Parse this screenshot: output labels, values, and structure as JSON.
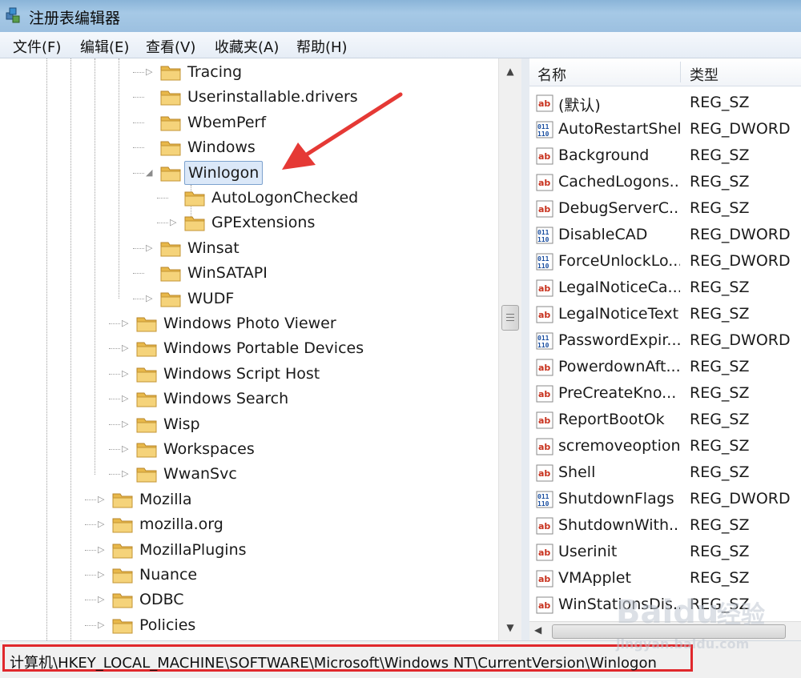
{
  "window": {
    "title": "注册表编辑器"
  },
  "menu": [
    "文件(F)",
    "编辑(E)",
    "查看(V)",
    "收藏夹(A)",
    "帮助(H)"
  ],
  "tree": [
    {
      "label": "Tracing",
      "expander": "▷"
    },
    {
      "label": "Userinstallable.drivers",
      "expander": ""
    },
    {
      "label": "WbemPerf",
      "expander": ""
    },
    {
      "label": "Windows",
      "expander": ""
    },
    {
      "label": "Winlogon",
      "expander": "◢",
      "selected": true
    },
    {
      "label": "AutoLogonChecked",
      "expander": ""
    },
    {
      "label": "GPExtensions",
      "expander": "▷"
    },
    {
      "label": "Winsat",
      "expander": "▷"
    },
    {
      "label": "WinSATAPI",
      "expander": ""
    },
    {
      "label": "WUDF",
      "expander": "▷"
    },
    {
      "label": "Windows Photo Viewer",
      "expander": "▷"
    },
    {
      "label": "Windows Portable Devices",
      "expander": "▷"
    },
    {
      "label": "Windows Script Host",
      "expander": "▷"
    },
    {
      "label": "Windows Search",
      "expander": "▷"
    },
    {
      "label": "Wisp",
      "expander": "▷"
    },
    {
      "label": "Workspaces",
      "expander": "▷"
    },
    {
      "label": "WwanSvc",
      "expander": "▷"
    },
    {
      "label": "Mozilla",
      "expander": "▷"
    },
    {
      "label": "mozilla.org",
      "expander": "▷"
    },
    {
      "label": "MozillaPlugins",
      "expander": "▷"
    },
    {
      "label": "Nuance",
      "expander": "▷"
    },
    {
      "label": "ODBC",
      "expander": "▷"
    },
    {
      "label": "Policies",
      "expander": "▷"
    }
  ],
  "list": {
    "headers": {
      "name": "名称",
      "type": "类型"
    },
    "rows": [
      {
        "icon": "string-value-icon",
        "name": "(默认)",
        "type": "REG_SZ"
      },
      {
        "icon": "binary-value-icon",
        "name": "AutoRestartShell",
        "type": "REG_DWORD"
      },
      {
        "icon": "string-value-icon",
        "name": "Background",
        "type": "REG_SZ"
      },
      {
        "icon": "string-value-icon",
        "name": "CachedLogons...",
        "type": "REG_SZ"
      },
      {
        "icon": "string-value-icon",
        "name": "DebugServerC...",
        "type": "REG_SZ"
      },
      {
        "icon": "binary-value-icon",
        "name": "DisableCAD",
        "type": "REG_DWORD"
      },
      {
        "icon": "binary-value-icon",
        "name": "ForceUnlockLo...",
        "type": "REG_DWORD"
      },
      {
        "icon": "string-value-icon",
        "name": "LegalNoticeCa...",
        "type": "REG_SZ"
      },
      {
        "icon": "string-value-icon",
        "name": "LegalNoticeText",
        "type": "REG_SZ"
      },
      {
        "icon": "binary-value-icon",
        "name": "PasswordExpir...",
        "type": "REG_DWORD"
      },
      {
        "icon": "string-value-icon",
        "name": "PowerdownAft...",
        "type": "REG_SZ"
      },
      {
        "icon": "string-value-icon",
        "name": "PreCreateKno...",
        "type": "REG_SZ"
      },
      {
        "icon": "string-value-icon",
        "name": "ReportBootOk",
        "type": "REG_SZ"
      },
      {
        "icon": "string-value-icon",
        "name": "scremoveoption",
        "type": "REG_SZ"
      },
      {
        "icon": "string-value-icon",
        "name": "Shell",
        "type": "REG_SZ"
      },
      {
        "icon": "binary-value-icon",
        "name": "ShutdownFlags",
        "type": "REG_DWORD"
      },
      {
        "icon": "string-value-icon",
        "name": "ShutdownWith...",
        "type": "REG_SZ"
      },
      {
        "icon": "string-value-icon",
        "name": "Userinit",
        "type": "REG_SZ"
      },
      {
        "icon": "string-value-icon",
        "name": "VMApplet",
        "type": "REG_SZ"
      },
      {
        "icon": "string-value-icon",
        "name": "WinStationsDis...",
        "type": "REG_SZ"
      }
    ]
  },
  "status": {
    "path": "计算机\\HKEY_LOCAL_MACHINE\\SOFTWARE\\Microsoft\\Windows NT\\CurrentVersion\\Winlogon"
  },
  "watermark": {
    "brand": "Baidu",
    "brand_cn": "经验",
    "url": "jingyan.baidu.com"
  },
  "colors": {
    "highlight_border": "#e0282c",
    "annotation_arrow": "#e53935",
    "selection": "#dbe8f8"
  },
  "icons": {
    "folder": "folder-icon",
    "string": "string-value-icon",
    "binary": "binary-value-icon"
  }
}
